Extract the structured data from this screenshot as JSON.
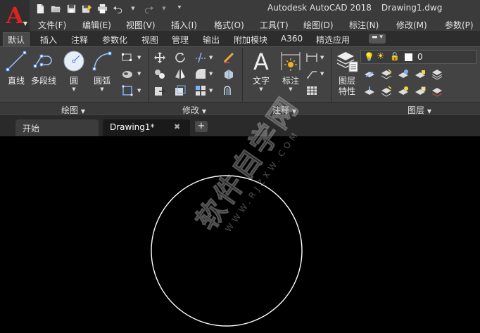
{
  "titlebar": {
    "app_name": "Autodesk AutoCAD 2018",
    "document": "Drawing1.dwg"
  },
  "app_logo": {
    "letter": "A"
  },
  "menu": {
    "items": [
      "文件(F)",
      "编辑(E)",
      "视图(V)",
      "插入(I)",
      "格式(O)",
      "工具(T)",
      "绘图(D)",
      "标注(N)",
      "修改(M)",
      "参数(P)"
    ]
  },
  "ribbon_tabs": {
    "items": [
      "默认",
      "插入",
      "注释",
      "参数化",
      "视图",
      "管理",
      "输出",
      "附加模块",
      "A360",
      "精选应用"
    ],
    "active": "默认"
  },
  "ribbon": {
    "draw": {
      "title": "绘图",
      "line": "直线",
      "polyline": "多段线",
      "circle": "圆",
      "arc": "圆弧"
    },
    "modify": {
      "title": "修改"
    },
    "annotate": {
      "title": "注释",
      "text": "文字",
      "dimension": "标注"
    },
    "layers": {
      "title": "图层",
      "properties_line1": "图层",
      "properties_line2": "特性",
      "current_layer": "0"
    }
  },
  "file_tabs": {
    "start": "开始",
    "drawing": "Drawing1*",
    "close_glyph": "✖",
    "add_glyph": "+"
  },
  "watermark": {
    "text": "软件自学网",
    "url": "WWW.RJZXW.COM"
  },
  "colors": {
    "logo_red": "#d22222",
    "ui_dark": "#3b3b3b",
    "canvas": "#000000",
    "circle_stroke": "#ffffff"
  }
}
